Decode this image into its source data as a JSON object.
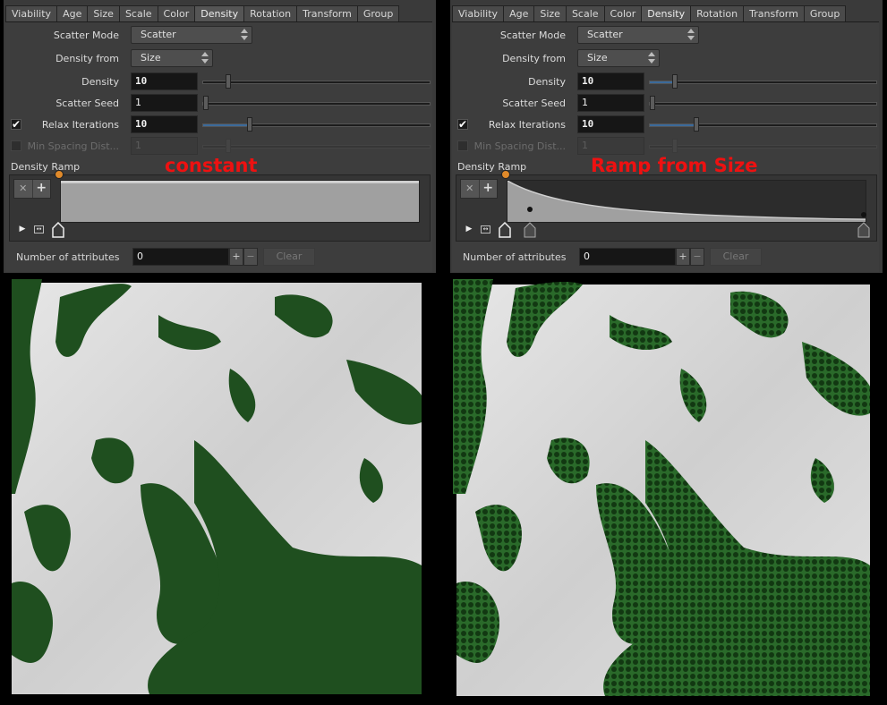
{
  "panels": [
    {
      "tabs": [
        "Viability",
        "Age",
        "Size",
        "Scale",
        "Color",
        "Density",
        "Rotation",
        "Transform",
        "Group"
      ],
      "active_tab": "Density",
      "scatter_mode": {
        "label": "Scatter Mode",
        "value": "Scatter"
      },
      "density_from": {
        "label": "Density from",
        "value": "Size"
      },
      "density": {
        "label": "Density",
        "value": "10",
        "slider_fraction": 0.1
      },
      "scatter_seed": {
        "label": "Scatter Seed",
        "value": "1",
        "slider_fraction": 0.0
      },
      "relax_iterations": {
        "label": "Relax Iterations",
        "value": "10",
        "checked": true,
        "slider_fraction": 0.2
      },
      "min_spacing": {
        "label": "Min Spacing Dist...",
        "value": "1",
        "checked": false,
        "enabled": false
      },
      "density_ramp_label": "Density Ramp",
      "annotation": "constant",
      "ramp_shape": "constant",
      "attributes": {
        "label": "Number of attributes",
        "value": "0",
        "clear_label": "Clear"
      }
    },
    {
      "tabs": [
        "Viability",
        "Age",
        "Size",
        "Scale",
        "Color",
        "Density",
        "Rotation",
        "Transform",
        "Group"
      ],
      "active_tab": "Density",
      "scatter_mode": {
        "label": "Scatter Mode",
        "value": "Scatter"
      },
      "density_from": {
        "label": "Density from",
        "value": "Size"
      },
      "density": {
        "label": "Density",
        "value": "10",
        "slider_fraction": 0.1
      },
      "scatter_seed": {
        "label": "Scatter Seed",
        "value": "1",
        "slider_fraction": 0.0
      },
      "relax_iterations": {
        "label": "Relax Iterations",
        "value": "10",
        "checked": true,
        "slider_fraction": 0.2
      },
      "min_spacing": {
        "label": "Min Spacing Dist...",
        "value": "1",
        "checked": false,
        "enabled": false
      },
      "density_ramp_label": "Density Ramp",
      "annotation": "Ramp from Size",
      "ramp_shape": "decay",
      "attributes": {
        "label": "Number of attributes",
        "value": "0",
        "clear_label": "Clear"
      }
    }
  ],
  "icons": {
    "ramp_delete": "close-icon",
    "ramp_add": "plus-icon",
    "ramp_play": "play-icon",
    "ramp_loop": "loop-icon",
    "checkmark": "check-icon"
  },
  "colors": {
    "annotation": "#ee1111",
    "foliage": "#1f5a1f",
    "terrain": "#d8d8d8",
    "slider_fill": "#3b6a9a"
  }
}
